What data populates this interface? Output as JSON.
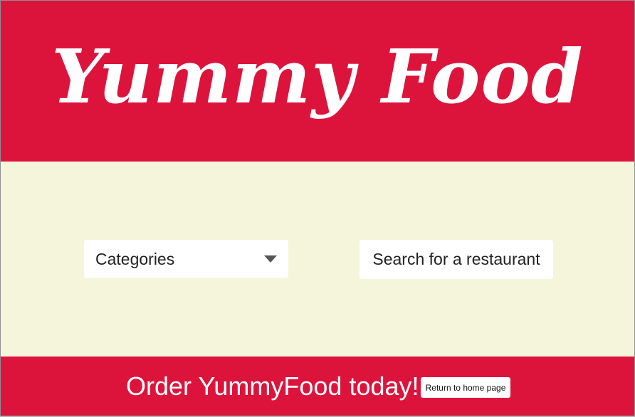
{
  "header": {
    "logo_text": "Yummy Food"
  },
  "filters": {
    "category_select": {
      "selected": "Categories"
    },
    "search_button_label": "Search for a restaurant"
  },
  "footer": {
    "tagline": "Order YummyFood today!",
    "home_button_label": "Return to home page"
  },
  "colors": {
    "brand_red": "#dc143c",
    "content_background": "#f5f5dc",
    "control_background": "#ffffff"
  },
  "icons": {
    "select_caret": "chevron-down-icon"
  }
}
